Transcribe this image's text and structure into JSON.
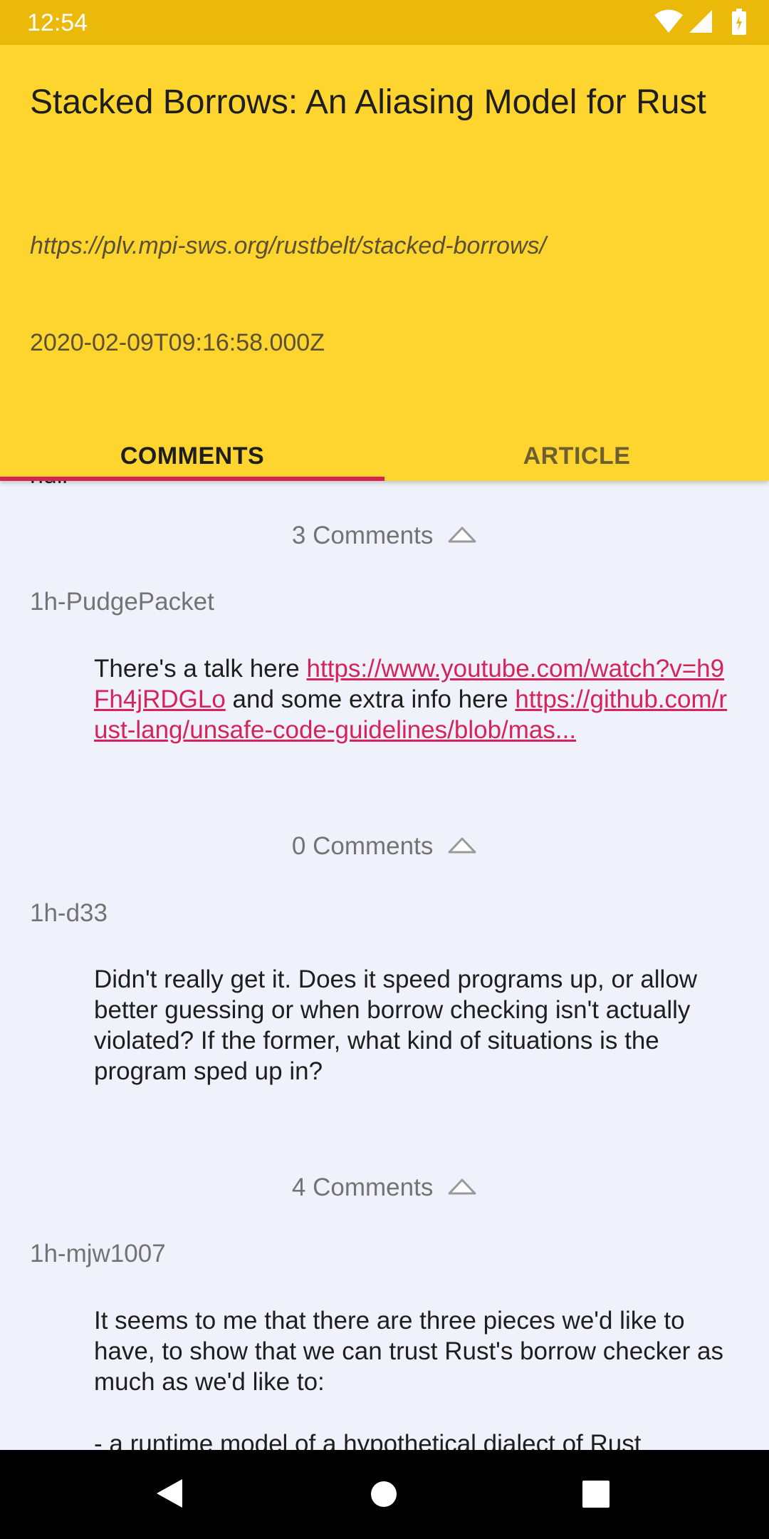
{
  "status_bar": {
    "time": "12:54",
    "icons": [
      "wifi-icon",
      "signal-icon",
      "battery-icon"
    ],
    "color": "#eab90a"
  },
  "header": {
    "title": "Stacked Borrows: An Aliasing Model for Rust",
    "url": "https://plv.mpi-sws.org/rustbelt/stacked-borrows/",
    "date": "2020-02-09T09:16:58.000Z",
    "background": "#fed42f"
  },
  "tabs": [
    {
      "label": "COMMENTS",
      "selected": true
    },
    {
      "label": "ARTICLE",
      "selected": false
    }
  ],
  "accent_color": "#d6234f",
  "content": {
    "cut_off_text": "null",
    "comments": [
      {
        "count_label": "3 Comments",
        "author": "1h-PudgePacket",
        "text_before_link1": "There's a talk here ",
        "link1": "https://www.youtube.com/watch?v=h9Fh4jRDGLo",
        "text_between": " and some extra info here ",
        "link2": "https://github.com/rust-lang/unsafe-code-guidelines/blob/mas..."
      },
      {
        "count_label": "0 Comments",
        "author": "1h-d33",
        "text": "Didn't really get it. Does it speed programs up, or allow better guessing or when borrow checking isn't actually violated? If the former, what kind of situations is the program sped up in?"
      },
      {
        "count_label": "4 Comments",
        "author": "1h-mjw1007",
        "text": "It seems to me that there are three pieces we'd like to have, to show that we can trust Rust's borrow checker as much as we'd like to:",
        "text_continued": "- a runtime model of a hypothetical dialect of Rust"
      }
    ]
  },
  "nav_bar": {
    "buttons": [
      "back-icon",
      "home-icon",
      "recents-icon"
    ]
  }
}
